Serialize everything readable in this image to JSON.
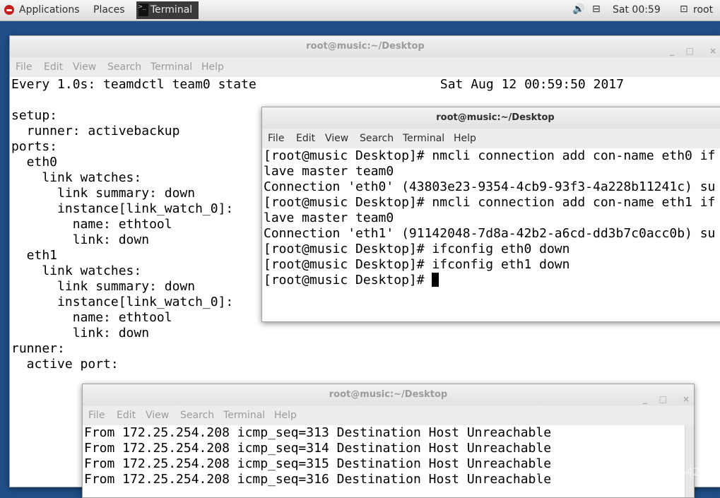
{
  "topbar": {
    "applications": "Applications",
    "places": "Places",
    "taskbar_terminal": "Terminal",
    "clock": "Sat 00:59",
    "user": "root"
  },
  "window_main": {
    "title": "root@music:~/Desktop",
    "menu": [
      "File",
      "Edit",
      "View",
      "Search",
      "Terminal",
      "Help"
    ],
    "lines": [
      "Every 1.0s: teamdctl team0 state                        Sat Aug 12 00:59:50 2017",
      "",
      "setup:",
      "  runner: activebackup",
      "ports:",
      "  eth0",
      "    link watches:",
      "      link summary: down",
      "      instance[link_watch_0]:",
      "        name: ethtool",
      "        link: down",
      "  eth1",
      "    link watches:",
      "      link summary: down",
      "      instance[link_watch_0]:",
      "        name: ethtool",
      "        link: down",
      "runner:",
      "  active port:"
    ]
  },
  "window_cmd": {
    "title": "root@music:~/Desktop",
    "menu": [
      "File",
      "Edit",
      "View",
      "Search",
      "Terminal",
      "Help"
    ],
    "lines": [
      "[root@music Desktop]# nmcli connection add con-name eth0 if",
      "lave master team0",
      "Connection 'eth0' (43803e23-9354-4cb9-93f3-4a228b11241c) su",
      "[root@music Desktop]# nmcli connection add con-name eth1 if",
      "lave master team0",
      "Connection 'eth1' (91142048-7d8a-42b2-a6cd-dd3b7c0acc0b) su",
      "[root@music Desktop]# ifconfig eth0 down",
      "[root@music Desktop]# ifconfig eth1 down"
    ],
    "prompt": "[root@music Desktop]# "
  },
  "window_ping": {
    "title": "root@music:~/Desktop",
    "menu": [
      "File",
      "Edit",
      "View",
      "Search",
      "Terminal",
      "Help"
    ],
    "lines": [
      "From 172.25.254.208 icmp_seq=313 Destination Host Unreachable",
      "From 172.25.254.208 icmp_seq=314 Destination Host Unreachable",
      "From 172.25.254.208 icmp_seq=315 Destination Host Unreachable",
      "From 172.25.254.208 icmp_seq=316 Destination Host Unreachable"
    ]
  },
  "watermark": "https://blog.csdn.net/weixin_4542928",
  "icons": {
    "window_minimize": "_",
    "window_maximize": "□",
    "window_close": "×",
    "speaker": "🔊",
    "network": "⊟",
    "user": "⊡"
  }
}
